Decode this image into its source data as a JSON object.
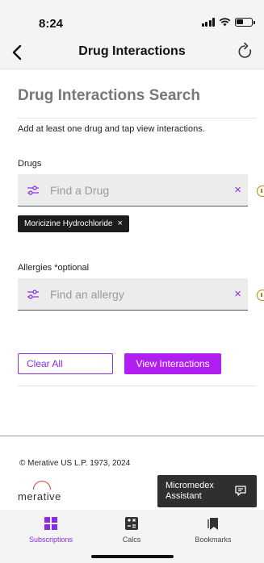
{
  "status_bar": {
    "time": "8:24"
  },
  "nav": {
    "title": "Drug Interactions"
  },
  "page": {
    "heading": "Drug Interactions Search",
    "instructions": "Add at least one drug and tap view interactions."
  },
  "drugs": {
    "label": "Drugs",
    "placeholder": "Find a Drug",
    "clear_glyph": "×",
    "selected": [
      {
        "name": "Moricizine Hydrochloride",
        "remove_glyph": "×"
      }
    ]
  },
  "allergies": {
    "label": "Allergies *optional",
    "placeholder": "Find an allergy",
    "clear_glyph": "×"
  },
  "actions": {
    "clear_all": "Clear All",
    "view_interactions": "View Interactions"
  },
  "footer": {
    "copyright": "© Merative US L.P. 1973, 2024",
    "logo_text": "merative",
    "assistant_label": "Micromedex\nAssistant"
  },
  "tabs": [
    {
      "label": "Subscriptions",
      "icon": "grid-icon",
      "active": true
    },
    {
      "label": "Calcs",
      "icon": "calculator-icon",
      "active": false
    },
    {
      "label": "Bookmarks",
      "icon": "bookmark-icon",
      "active": false
    }
  ],
  "colors": {
    "accent": "#8a2be2",
    "primary_button": "#b01ff0",
    "chip_bg": "#1c1c1c",
    "logo_red": "#e0362c"
  }
}
